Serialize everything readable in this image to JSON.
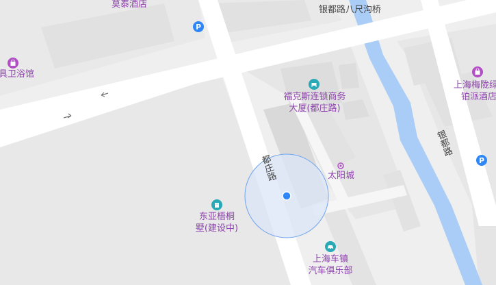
{
  "map": {
    "labels": {
      "motai_hotel": "莫泰酒店",
      "bath_shop": "具卫浴馆",
      "yindu_bridge": "银都路八尺沟桥",
      "fukesi_line1": "福克斯连锁商务",
      "fukesi_line2": "大厦(都庄路)",
      "meilong_line1": "上海梅陇绿",
      "meilong_line2": "铂派酒店",
      "dongya_line1": "东亚梧桐",
      "dongya_line2": "墅(建设中)",
      "taiyangcheng": "太阳城",
      "chezhen_line1": "上海车镇",
      "chezhen_line2": "汽车俱乐部",
      "duzhuang_road": "都庄路",
      "yindu_road": "银都路"
    },
    "icons": {
      "parking_glyph": "P"
    },
    "colors": {
      "background": "#efefef",
      "road": "#ffffff",
      "block": "#e6e6e6",
      "building": "#e0e0e0",
      "water": "#a9cdf6",
      "poi_text": "#8e44ad",
      "road_text": "#444444",
      "location_dot": "#2f86f6",
      "accuracy_fill": "#dbe6f8",
      "accuracy_stroke": "#6fa3ee"
    }
  }
}
